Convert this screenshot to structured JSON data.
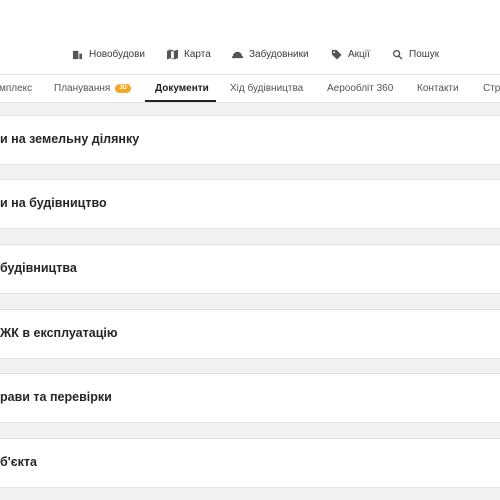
{
  "header": {
    "nav": [
      {
        "label": "Новобудови",
        "icon": "building-icon"
      },
      {
        "label": "Карта",
        "icon": "map-icon"
      },
      {
        "label": "Забудовники",
        "icon": "helmet-icon"
      },
      {
        "label": "Акції",
        "icon": "tag-icon"
      },
      {
        "label": "Пошук",
        "icon": "search-icon"
      }
    ]
  },
  "tabs": [
    {
      "label": "мплекс"
    },
    {
      "label": "Планування",
      "badge": "3D"
    },
    {
      "label": "Документи",
      "active": true
    },
    {
      "label": "Хід будівництва"
    },
    {
      "label": "Аерообліт 360"
    },
    {
      "label": "Контакти"
    },
    {
      "label": "Стр"
    }
  ],
  "documents": [
    {
      "title": "и на земельну ділянку"
    },
    {
      "title": "и на будівництво"
    },
    {
      "title": "будівництва"
    },
    {
      "title": "ЖК в експлуатацію"
    },
    {
      "title": "рави та перевірки"
    },
    {
      "title": "б'єкта"
    }
  ]
}
